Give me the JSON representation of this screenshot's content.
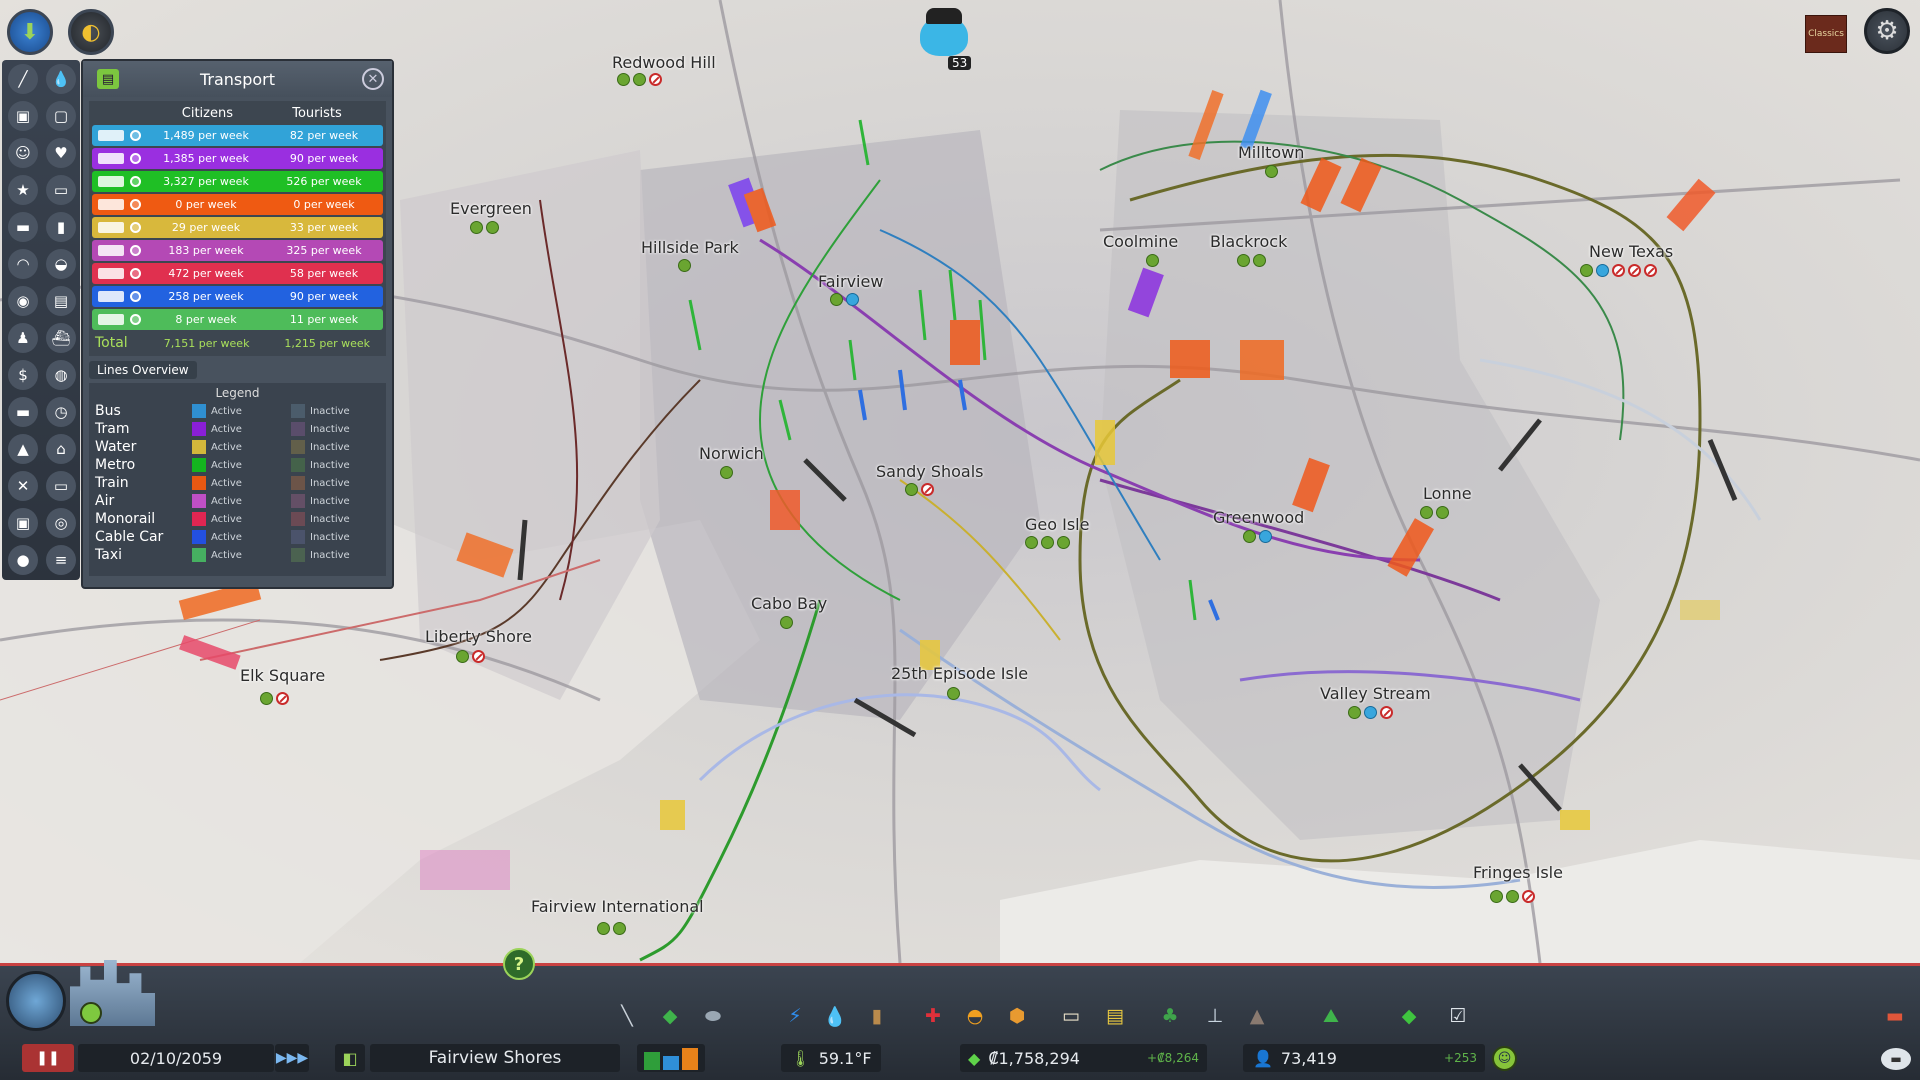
{
  "panel": {
    "title": "Transport",
    "col_citizens": "Citizens",
    "col_tourists": "Tourists",
    "rows": [
      {
        "icon": "bus-icon",
        "color": "#31a3d8",
        "citizens": "1,489 per week",
        "tourists": "82 per week"
      },
      {
        "icon": "tram-icon",
        "color": "#9a2fe0",
        "citizens": "1,385 per week",
        "tourists": "90 per week"
      },
      {
        "icon": "metro-icon",
        "color": "#1fbf25",
        "citizens": "3,327 per week",
        "tourists": "526 per week"
      },
      {
        "icon": "train-icon",
        "color": "#ef5a12",
        "citizens": "0 per week",
        "tourists": "0 per week"
      },
      {
        "icon": "ship-icon",
        "color": "#d8b83c",
        "citizens": "29 per week",
        "tourists": "33 per week"
      },
      {
        "icon": "airplane-icon",
        "color": "#b449b5",
        "citizens": "183 per week",
        "tourists": "325 per week"
      },
      {
        "icon": "monorail-icon",
        "color": "#e0304f",
        "citizens": "472 per week",
        "tourists": "58 per week"
      },
      {
        "icon": "cable-car-icon",
        "color": "#2262e0",
        "citizens": "258 per week",
        "tourists": "90 per week"
      },
      {
        "icon": "taxi-icon",
        "color": "#4ebc5a",
        "citizens": "8 per week",
        "tourists": "11 per week"
      }
    ],
    "total_label": "Total",
    "total_citizens": "7,151 per week",
    "total_tourists": "1,215 per week",
    "lines_tab": "Lines Overview",
    "legend_title": "Legend",
    "legend": [
      {
        "name": "Bus",
        "active_color": "#2f8fd0",
        "inactive_color": "#4b5c6b",
        "active": "Active",
        "inactive": "Inactive"
      },
      {
        "name": "Tram",
        "active_color": "#8a1fd8",
        "inactive_color": "#5a4d6b",
        "active": "Active",
        "inactive": "Inactive"
      },
      {
        "name": "Water",
        "active_color": "#d3b73b",
        "inactive_color": "#625f4a",
        "active": "Active",
        "inactive": "Inactive"
      },
      {
        "name": "Metro",
        "active_color": "#14b51f",
        "inactive_color": "#44624a",
        "active": "Active",
        "inactive": "Inactive"
      },
      {
        "name": "Train",
        "active_color": "#e85812",
        "inactive_color": "#6c5448",
        "active": "Active",
        "inactive": "Inactive"
      },
      {
        "name": "Air",
        "active_color": "#c04fc5",
        "inactive_color": "#644f66",
        "active": "Active",
        "inactive": "Inactive"
      },
      {
        "name": "Monorail",
        "active_color": "#e02652",
        "inactive_color": "#6b4a54",
        "active": "Active",
        "inactive": "Inactive"
      },
      {
        "name": "Cable Car",
        "active_color": "#2350e0",
        "inactive_color": "#4b536b",
        "active": "Active",
        "inactive": "Inactive"
      },
      {
        "name": "Taxi",
        "active_color": "#46b061",
        "inactive_color": "#4b6250",
        "active": "Active",
        "inactive": "Inactive"
      }
    ]
  },
  "districts": [
    {
      "name": "Redwood Hill",
      "icons": [
        "green",
        "green",
        "no"
      ]
    },
    {
      "name": "Evergreen",
      "icons": [
        "green",
        "green"
      ]
    },
    {
      "name": "Hillside Park",
      "icons": [
        "green"
      ]
    },
    {
      "name": "Fairview",
      "icons": [
        "green",
        "blue"
      ]
    },
    {
      "name": "Norwich",
      "icons": [
        "green"
      ]
    },
    {
      "name": "Sandy Shoals",
      "icons": [
        "green",
        "no"
      ]
    },
    {
      "name": "Geo Isle",
      "icons": [
        "green",
        "green",
        "green"
      ]
    },
    {
      "name": "Cabo Bay",
      "icons": [
        "green"
      ]
    },
    {
      "name": "Liberty Shore",
      "icons": [
        "green",
        "no"
      ]
    },
    {
      "name": "Elk Square",
      "icons": [
        "green",
        "no"
      ]
    },
    {
      "name": "25th Episode Isle",
      "icons": [
        "green"
      ]
    },
    {
      "name": "Fairview International",
      "icons": [
        "green",
        "green"
      ]
    },
    {
      "name": "Milltown",
      "icons": [
        "green"
      ]
    },
    {
      "name": "Coolmine",
      "icons": [
        "green"
      ]
    },
    {
      "name": "Blackrock",
      "icons": [
        "green",
        "green"
      ]
    },
    {
      "name": "New Texas",
      "icons": [
        "green",
        "blue",
        "no",
        "no",
        "no"
      ]
    },
    {
      "name": "Greenwood",
      "icons": [
        "green",
        "blue"
      ]
    },
    {
      "name": "Lonne",
      "icons": [
        "green",
        "green"
      ]
    },
    {
      "name": "Valley Stream",
      "icons": [
        "green",
        "blue",
        "no"
      ]
    },
    {
      "name": "Fringes Isle",
      "icons": [
        "green",
        "green",
        "no"
      ]
    }
  ],
  "top": {
    "chirper_count": "53",
    "classics_label": "Classics",
    "help_label": "?"
  },
  "left_tools": [
    "roads-icon",
    "water-drop-icon",
    "garbage-icon",
    "box-icon",
    "smile-icon",
    "heart-icon",
    "star-icon",
    "ticket-icon",
    "car-icon",
    "tube-icon",
    "helmet-icon",
    "police-icon",
    "gas-mask-icon",
    "bus-icon",
    "person-icon",
    "ship-icon",
    "money-icon",
    "globe-icon",
    "train-icon",
    "clock-icon",
    "terrain-icon",
    "house-icon",
    "tools-icon",
    "battery-icon",
    "camera-icon",
    "radio-icon",
    "traffic-icon",
    "list-icon"
  ],
  "bottom": {
    "date": "02/10/2059",
    "city_name": "Fairview Shores",
    "temperature": "59.1°F",
    "money": "₡1,758,294",
    "money_delta": "+₡8,264",
    "population": "73,419",
    "population_delta": "+253",
    "tools": [
      {
        "icon": "road-icon",
        "color": "#c9d1d9"
      },
      {
        "icon": "zoning-icon",
        "color": "#3fb44b"
      },
      {
        "icon": "district-icon",
        "color": "#9aa7b3"
      },
      {
        "icon": "electricity-icon",
        "color": "#2f8ff0"
      },
      {
        "icon": "water-icon",
        "color": "#2fa8e8"
      },
      {
        "icon": "garbage-icon",
        "color": "#b98a4c"
      },
      {
        "icon": "healthcare-icon",
        "color": "#e0303a"
      },
      {
        "icon": "fire-icon",
        "color": "#f0a020"
      },
      {
        "icon": "police-icon",
        "color": "#e89a30"
      },
      {
        "icon": "education-icon",
        "color": "#e8e0c8"
      },
      {
        "icon": "public-transport-icon",
        "color": "#e8c840"
      },
      {
        "icon": "beautification-icon",
        "color": "#3fa44b"
      },
      {
        "icon": "monuments-icon",
        "color": "#c9d5e0"
      },
      {
        "icon": "wonders-icon",
        "color": "#8a7a70"
      },
      {
        "icon": "landscaping-icon",
        "color": "#3fb44b"
      },
      {
        "icon": "money-icon",
        "color": "#3fc43f"
      },
      {
        "icon": "checklist-icon",
        "color": "#dfe5ea"
      },
      {
        "icon": "bulldozer-icon",
        "color": "#e0563a"
      }
    ]
  }
}
